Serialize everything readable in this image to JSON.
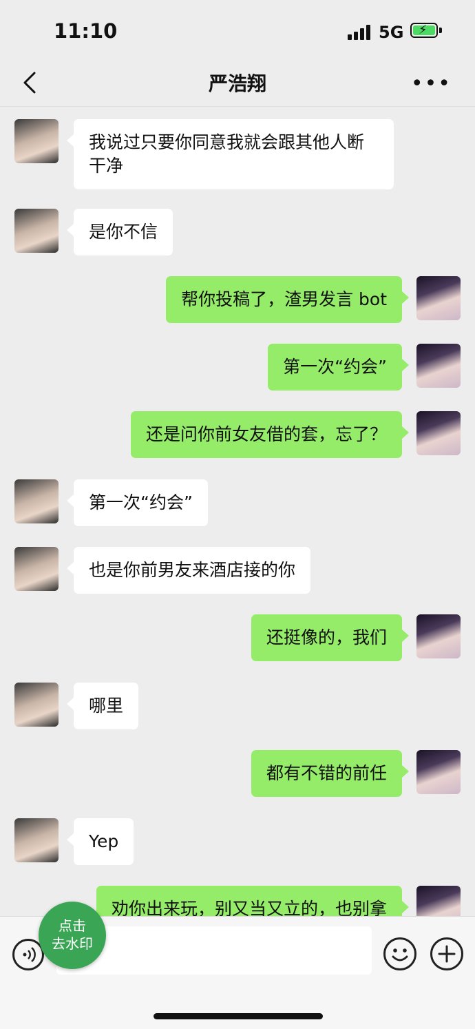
{
  "status_bar": {
    "time": "11:10",
    "network": "5G"
  },
  "header": {
    "title": "严浩翔"
  },
  "messages": [
    {
      "side": "in",
      "text": "我说过只要你同意我就会跟其他人断\n干净"
    },
    {
      "side": "in",
      "text": "是你不信"
    },
    {
      "side": "out",
      "text": "帮你投稿了，渣男发言 bot"
    },
    {
      "side": "out",
      "text": "第一次“约会”"
    },
    {
      "side": "out",
      "text": "还是问你前女友借的套，忘了？"
    },
    {
      "side": "in",
      "text": "第一次“约会”"
    },
    {
      "side": "in",
      "text": "也是你前男友来酒店接的你"
    },
    {
      "side": "out",
      "text": "还挺像的，我们"
    },
    {
      "side": "in",
      "text": "哪里"
    },
    {
      "side": "out",
      "text": "都有不错的前任"
    },
    {
      "side": "in",
      "text": "Yep"
    },
    {
      "side": "out",
      "text": "劝你出来玩，别又当又立的，也别拿"
    }
  ],
  "watermark_button": {
    "line1": "点击",
    "line2": "去水印"
  },
  "icons": {
    "back": "chevron-left-icon",
    "more": "more-icon",
    "voice": "voice-icon",
    "emoji": "emoji-icon",
    "plus": "plus-icon"
  },
  "colors": {
    "outgoing_bubble": "#95ec69",
    "incoming_bubble": "#ffffff",
    "background": "#ededed",
    "watermark_button": "#3aa655"
  }
}
